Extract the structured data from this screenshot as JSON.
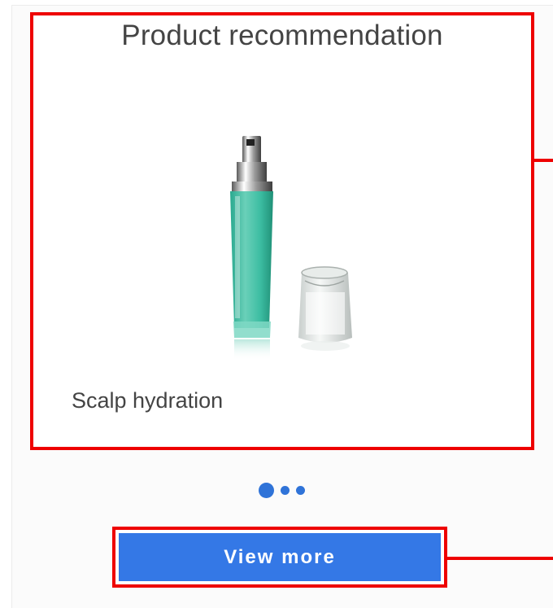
{
  "recommendation": {
    "title": "Product recommendation",
    "product_name": "Scalp hydration",
    "image_icon": "serum-bottle-image"
  },
  "pager": {
    "count": 3,
    "active_index": 0
  },
  "actions": {
    "view_more_label": "View more"
  },
  "colors": {
    "accent": "#3478e6",
    "highlight": "#ee0000",
    "text": "#444444"
  }
}
